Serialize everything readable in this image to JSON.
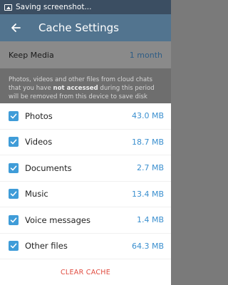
{
  "status_bar": {
    "text": "Saving screenshot..."
  },
  "app_bar": {
    "title": "Cache Settings"
  },
  "keep_media": {
    "label": "Keep Media",
    "value": "1 month"
  },
  "info": {
    "part1": "Photos, videos and other files from cloud chats that you have ",
    "bold": "not accessed",
    "part2": " during this period will be removed from this device to save disk space."
  },
  "items": [
    {
      "label": "Photos",
      "size": "43.0 MB",
      "checked": true
    },
    {
      "label": "Videos",
      "size": "18.7 MB",
      "checked": true
    },
    {
      "label": "Documents",
      "size": "2.7 MB",
      "checked": true
    },
    {
      "label": "Music",
      "size": "13.4 MB",
      "checked": true
    },
    {
      "label": "Voice messages",
      "size": "1.4 MB",
      "checked": true
    },
    {
      "label": "Other files",
      "size": "64.3 MB",
      "checked": true
    }
  ],
  "clear_button": {
    "label": "CLEAR CACHE"
  },
  "colors": {
    "accent": "#3f9cd8",
    "danger": "#e04b3f",
    "app_bar": "#52748f"
  }
}
